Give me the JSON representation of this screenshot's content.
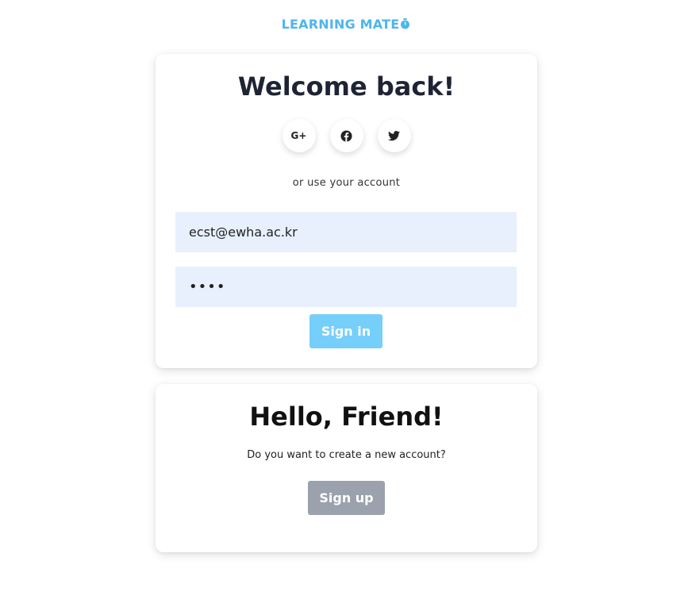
{
  "brand": {
    "name": "LEARNING MATE",
    "icon": "timer-icon",
    "color": "#4cb6ee"
  },
  "login": {
    "title": "Welcome back!",
    "socials": [
      {
        "label": "G+",
        "icon": "google-plus-icon"
      },
      {
        "label": "",
        "icon": "facebook-icon"
      },
      {
        "label": "",
        "icon": "twitter-icon"
      }
    ],
    "divider_text": "or use your account",
    "email": {
      "value": "ecst@ewha.ac.kr"
    },
    "password": {
      "value": "••••"
    },
    "signin_label": "Sign in",
    "signin_color": "#75cffa"
  },
  "signup": {
    "title": "Hello, Friend!",
    "subtitle": "Do you want to create a new account?",
    "signup_label": "Sign up",
    "signup_color": "#9ba2ad"
  }
}
